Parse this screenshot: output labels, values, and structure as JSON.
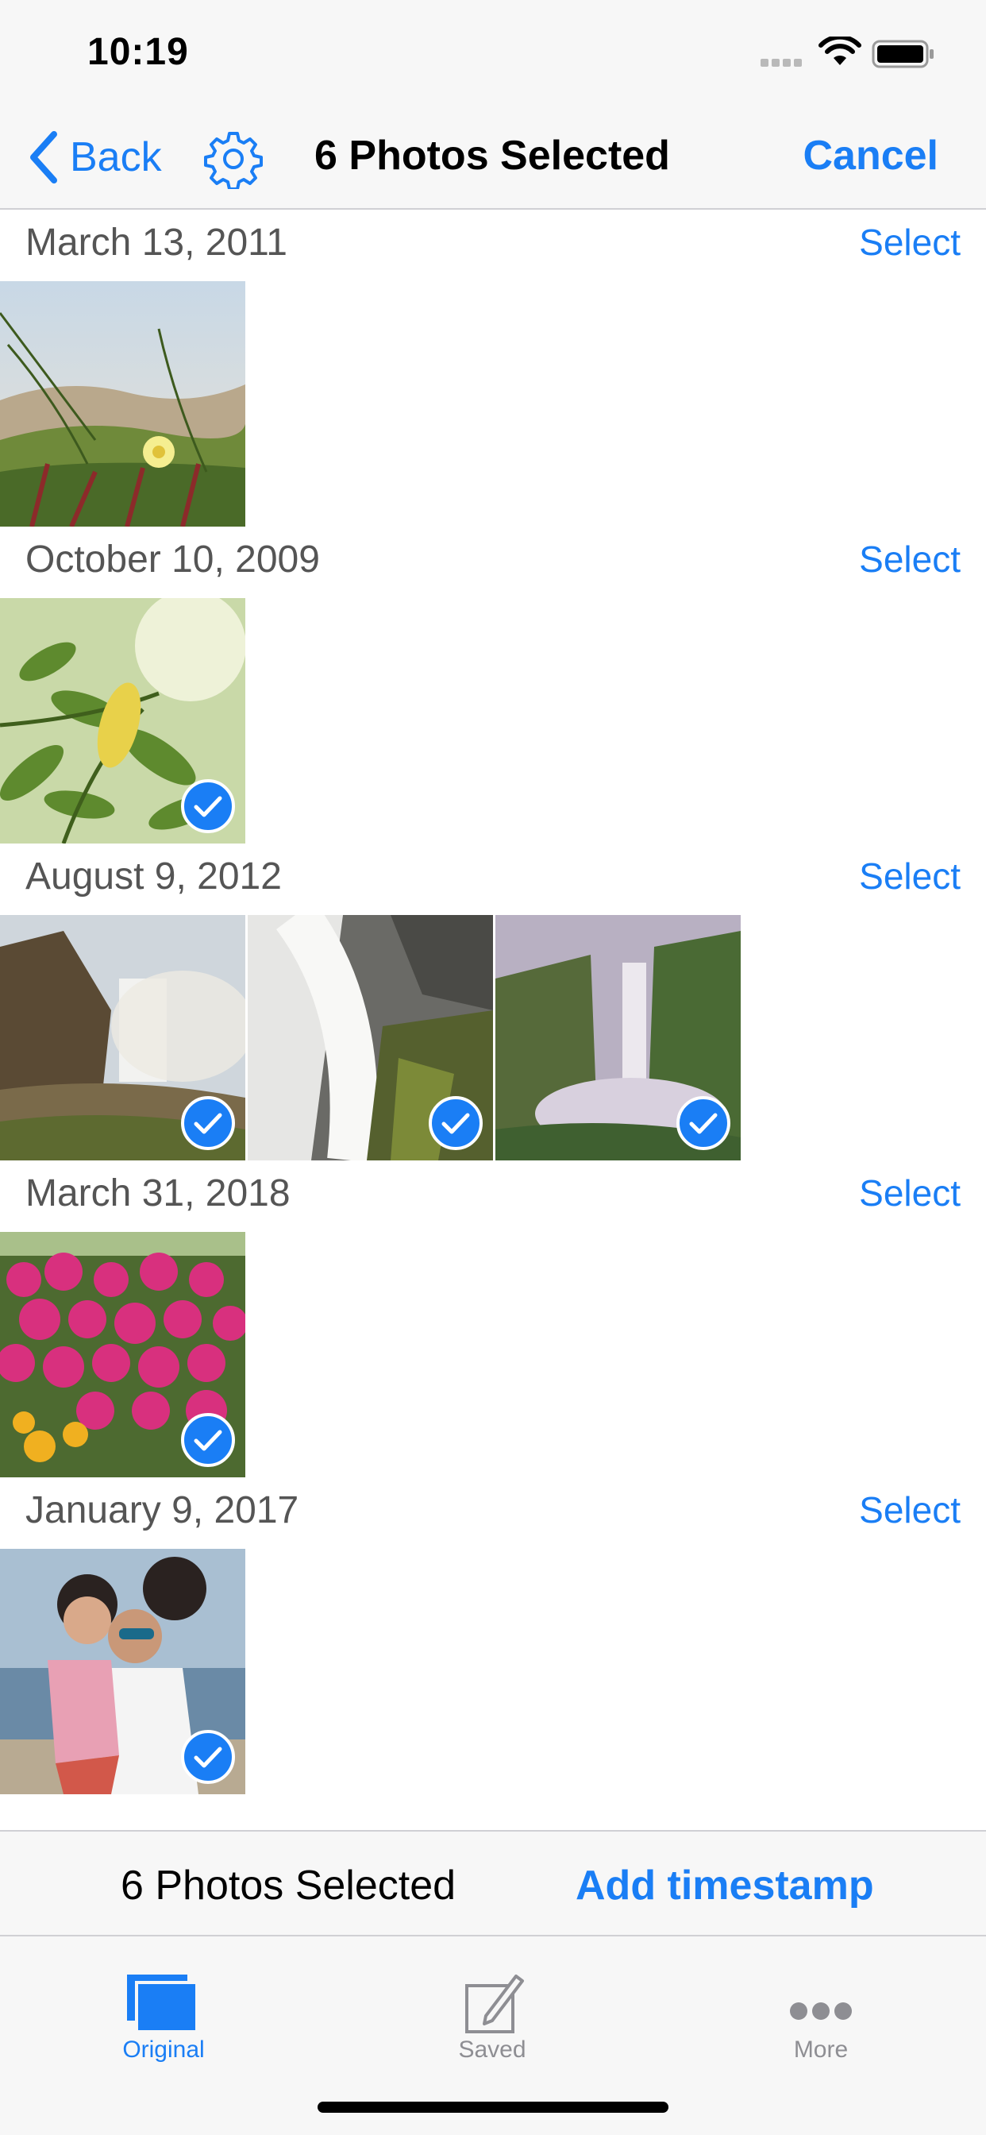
{
  "status": {
    "time": "10:19"
  },
  "nav": {
    "back_label": "Back",
    "title": "6 Photos Selected",
    "cancel_label": "Cancel"
  },
  "sections": [
    {
      "date": "March 13, 2011",
      "select_label": "Select"
    },
    {
      "date": "October 10, 2009",
      "select_label": "Select"
    },
    {
      "date": "August 9, 2012",
      "select_label": "Select"
    },
    {
      "date": "March 31, 2018",
      "select_label": "Select"
    },
    {
      "date": "January 9, 2017",
      "select_label": "Select"
    }
  ],
  "action_bar": {
    "count_label": "6 Photos Selected",
    "action_label": "Add timestamp"
  },
  "tabs": [
    {
      "label": "Original",
      "icon": "stacked-photos-icon",
      "active": true
    },
    {
      "label": "Saved",
      "icon": "edit-square-icon",
      "active": false
    },
    {
      "label": "More",
      "icon": "ellipsis-icon",
      "active": false
    }
  ],
  "colors": {
    "accent": "#1a7ef5",
    "bar_background": "#f7f7f7",
    "inactive": "#8e8e93"
  }
}
